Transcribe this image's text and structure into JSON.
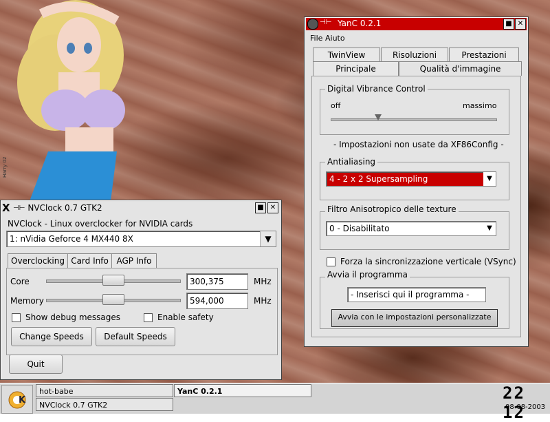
{
  "desktop": {
    "signature": "Harry 02"
  },
  "nvclock": {
    "title": "NVClock 0.7 GTK2",
    "subtitle": "NVClock - Linux overclocker for NVIDIA cards",
    "card_select": "1: nVidia Geforce 4 MX440 8X",
    "tabs": [
      "Overclocking",
      "Card Info",
      "AGP Info"
    ],
    "core_label": "Core",
    "core_value": "300,375",
    "core_unit": "MHz",
    "core_slider_fraction": 0.5,
    "memory_label": "Memory",
    "memory_value": "594,000",
    "memory_unit": "MHz",
    "memory_slider_fraction": 0.5,
    "debug_label": "Show debug messages",
    "safety_label": "Enable safety",
    "change_speeds": "Change Speeds",
    "default_speeds": "Default Speeds",
    "quit": "Quit"
  },
  "yanc": {
    "title": "YanC 0.2.1",
    "menu": [
      "File",
      "Aiuto"
    ],
    "tabs_back": [
      "TwinView",
      "Risoluzioni",
      "Prestazioni"
    ],
    "tabs_front": [
      "Principale",
      "Qualità d'immagine"
    ],
    "dvc_group": "Digital Vibrance Control",
    "dvc_off": "off",
    "dvc_max": "massimo",
    "dvc_fraction": 0.28,
    "note": "- Impostazioni non usate da XF86Config -",
    "aa_group": "Antialiasing",
    "aa_value": "4 - 2 x 2 Supersampling",
    "aniso_group": "Filtro Anisotropico delle texture",
    "aniso_value": "0 - Disabilitato",
    "vsync_label": "Forza la sincronizzazione verticale (VSync)",
    "launch_group": "Avvia il programma",
    "launch_input": "- Inserisci qui il programma -",
    "launch_button": "Avvia con le impostazioni personalizzate"
  },
  "taskbar": {
    "tasks": [
      "hot-babe",
      "NVClock 0.7 GTK2"
    ],
    "active_task": "YanC 0.2.1",
    "clock_time": "22 12",
    "clock_date": "08-08-2003"
  }
}
